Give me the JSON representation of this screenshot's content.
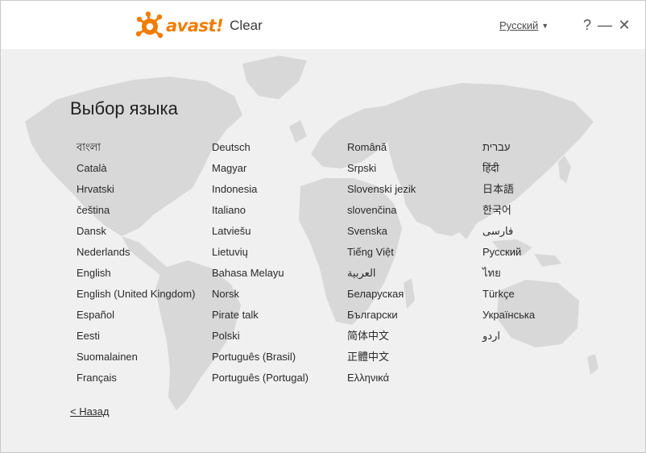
{
  "header": {
    "brand": "avast!",
    "product": "Clear",
    "current_language": "Русский",
    "help_label": "?",
    "minimize_label": "—",
    "close_label": "✕",
    "accent_color": "#f07d00"
  },
  "page": {
    "title": "Выбор языка",
    "back_label": "< Назад"
  },
  "languages": [
    [
      "বাংলা",
      "Català",
      "Hrvatski",
      "čeština",
      "Dansk",
      "Nederlands",
      "English",
      "English (United Kingdom)",
      "Español",
      "Eesti",
      "Suomalainen",
      "Français"
    ],
    [
      "Deutsch",
      "Magyar",
      "Indonesia",
      "Italiano",
      "Latviešu",
      "Lietuvių",
      "Bahasa Melayu",
      "Norsk",
      "Pirate talk",
      "Polski",
      "Português (Brasil)",
      "Português (Portugal)"
    ],
    [
      "Română",
      "Srpski",
      "Slovenski jezik",
      "slovenčina",
      "Svenska",
      "Tiếng Việt",
      "العربية",
      "Беларуская",
      "Български",
      "简体中文",
      "正體中文",
      "Ελληνικά"
    ],
    [
      "עברית",
      "हिंदी",
      "日本語",
      "한국어",
      "فارسی",
      "Русский",
      "ไทย",
      "Türkçe",
      "Українська",
      "اردو"
    ]
  ]
}
